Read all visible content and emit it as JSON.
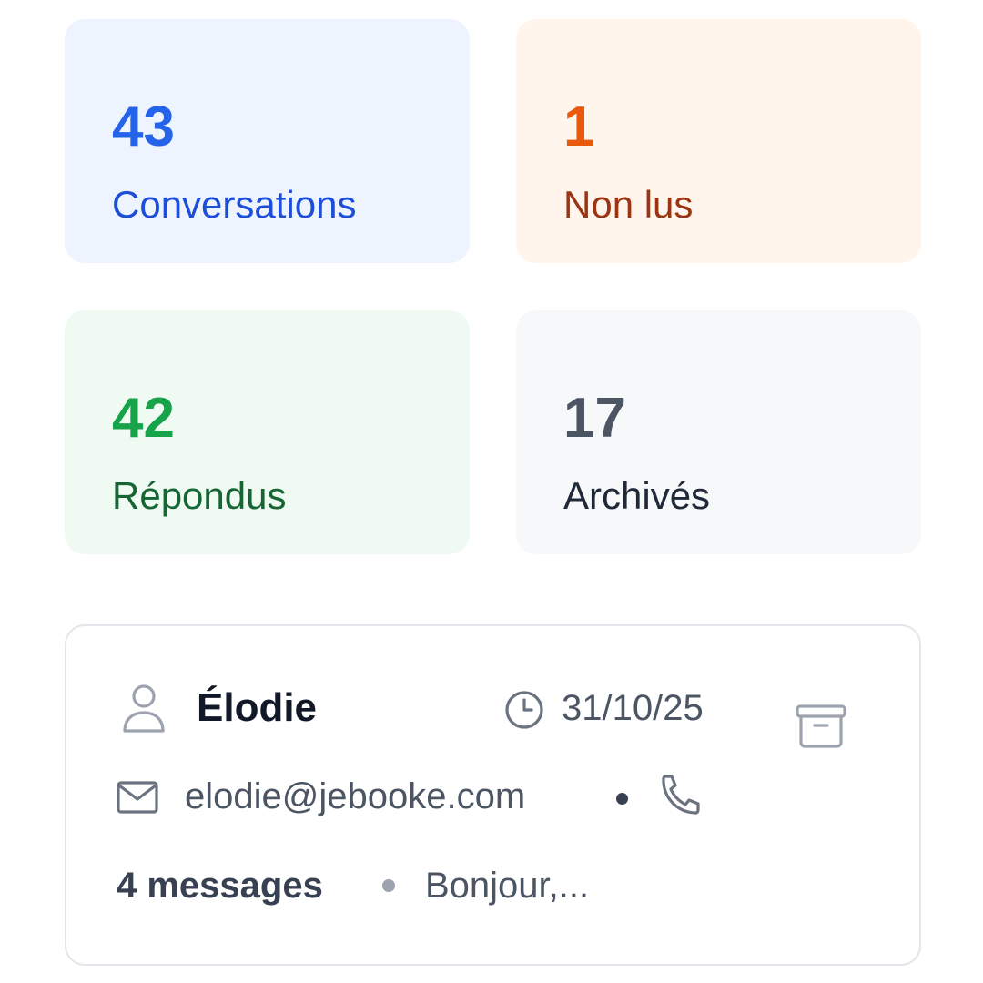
{
  "stats": [
    {
      "value": "43",
      "label": "Conversations",
      "value_color": "#2563eb",
      "label_color": "#1d4ed8",
      "bg": "#eef4fe"
    },
    {
      "value": "1",
      "label": "Non lus",
      "value_color": "#ea580c",
      "label_color": "#9a3412",
      "bg": "#fff5ec"
    },
    {
      "value": "42",
      "label": "Répondus",
      "value_color": "#16a34a",
      "label_color": "#166534",
      "bg": "#effaf2"
    },
    {
      "value": "17",
      "label": "Archivés",
      "value_color": "#4b5563",
      "label_color": "#1f2937",
      "bg": "#f7f8fa"
    }
  ],
  "conversation": {
    "name": "Élodie",
    "date": "31/10/25",
    "email": "elodie@jebooke.com",
    "message_count": "4 messages",
    "preview": "Bonjour,...",
    "icons": {
      "user": "user-icon",
      "clock": "clock-icon",
      "archive": "archive-icon",
      "mail": "mail-icon",
      "phone": "phone-icon"
    }
  }
}
